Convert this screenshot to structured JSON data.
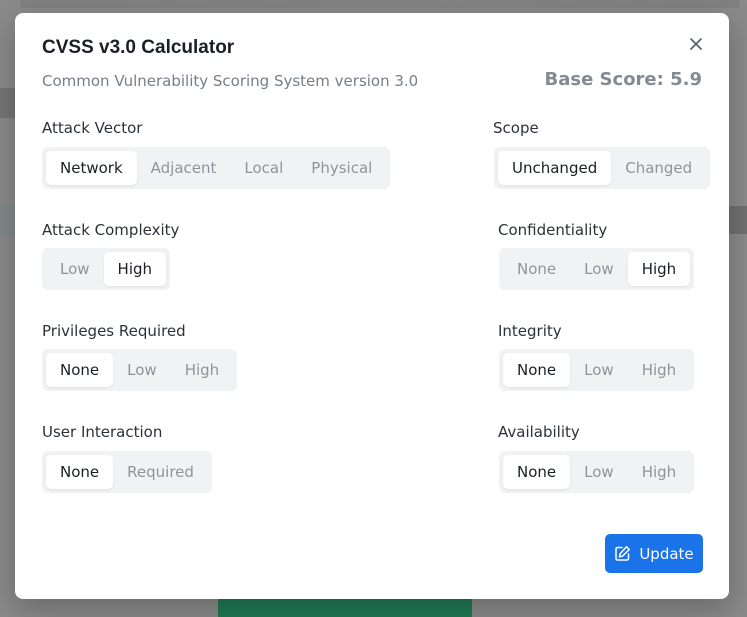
{
  "modal": {
    "title": "CVSS v3.0 Calculator",
    "subtitle": "Common Vulnerability Scoring System version 3.0",
    "base_score": "Base Score: 5.9",
    "update_label": "Update"
  },
  "metrics": {
    "attack_vector": {
      "label": "Attack Vector",
      "options": [
        "Network",
        "Adjacent",
        "Local",
        "Physical"
      ],
      "selected": "Network"
    },
    "attack_complexity": {
      "label": "Attack Complexity",
      "options": [
        "Low",
        "High"
      ],
      "selected": "High"
    },
    "privileges_required": {
      "label": "Privileges Required",
      "options": [
        "None",
        "Low",
        "High"
      ],
      "selected": "None"
    },
    "user_interaction": {
      "label": "User Interaction",
      "options": [
        "None",
        "Required"
      ],
      "selected": "None"
    },
    "scope": {
      "label": "Scope",
      "options": [
        "Unchanged",
        "Changed"
      ],
      "selected": "Unchanged"
    },
    "confidentiality": {
      "label": "Confidentiality",
      "options": [
        "None",
        "Low",
        "High"
      ],
      "selected": "High"
    },
    "integrity": {
      "label": "Integrity",
      "options": [
        "None",
        "Low",
        "High"
      ],
      "selected": "None"
    },
    "availability": {
      "label": "Availability",
      "options": [
        "None",
        "Low",
        "High"
      ],
      "selected": "None"
    }
  },
  "icons": {
    "close": "close-icon",
    "update": "edit-icon"
  },
  "colors": {
    "accent": "#1a73e8",
    "selected_bg": "#ffffff",
    "segment_bg": "#f1f2f4"
  }
}
